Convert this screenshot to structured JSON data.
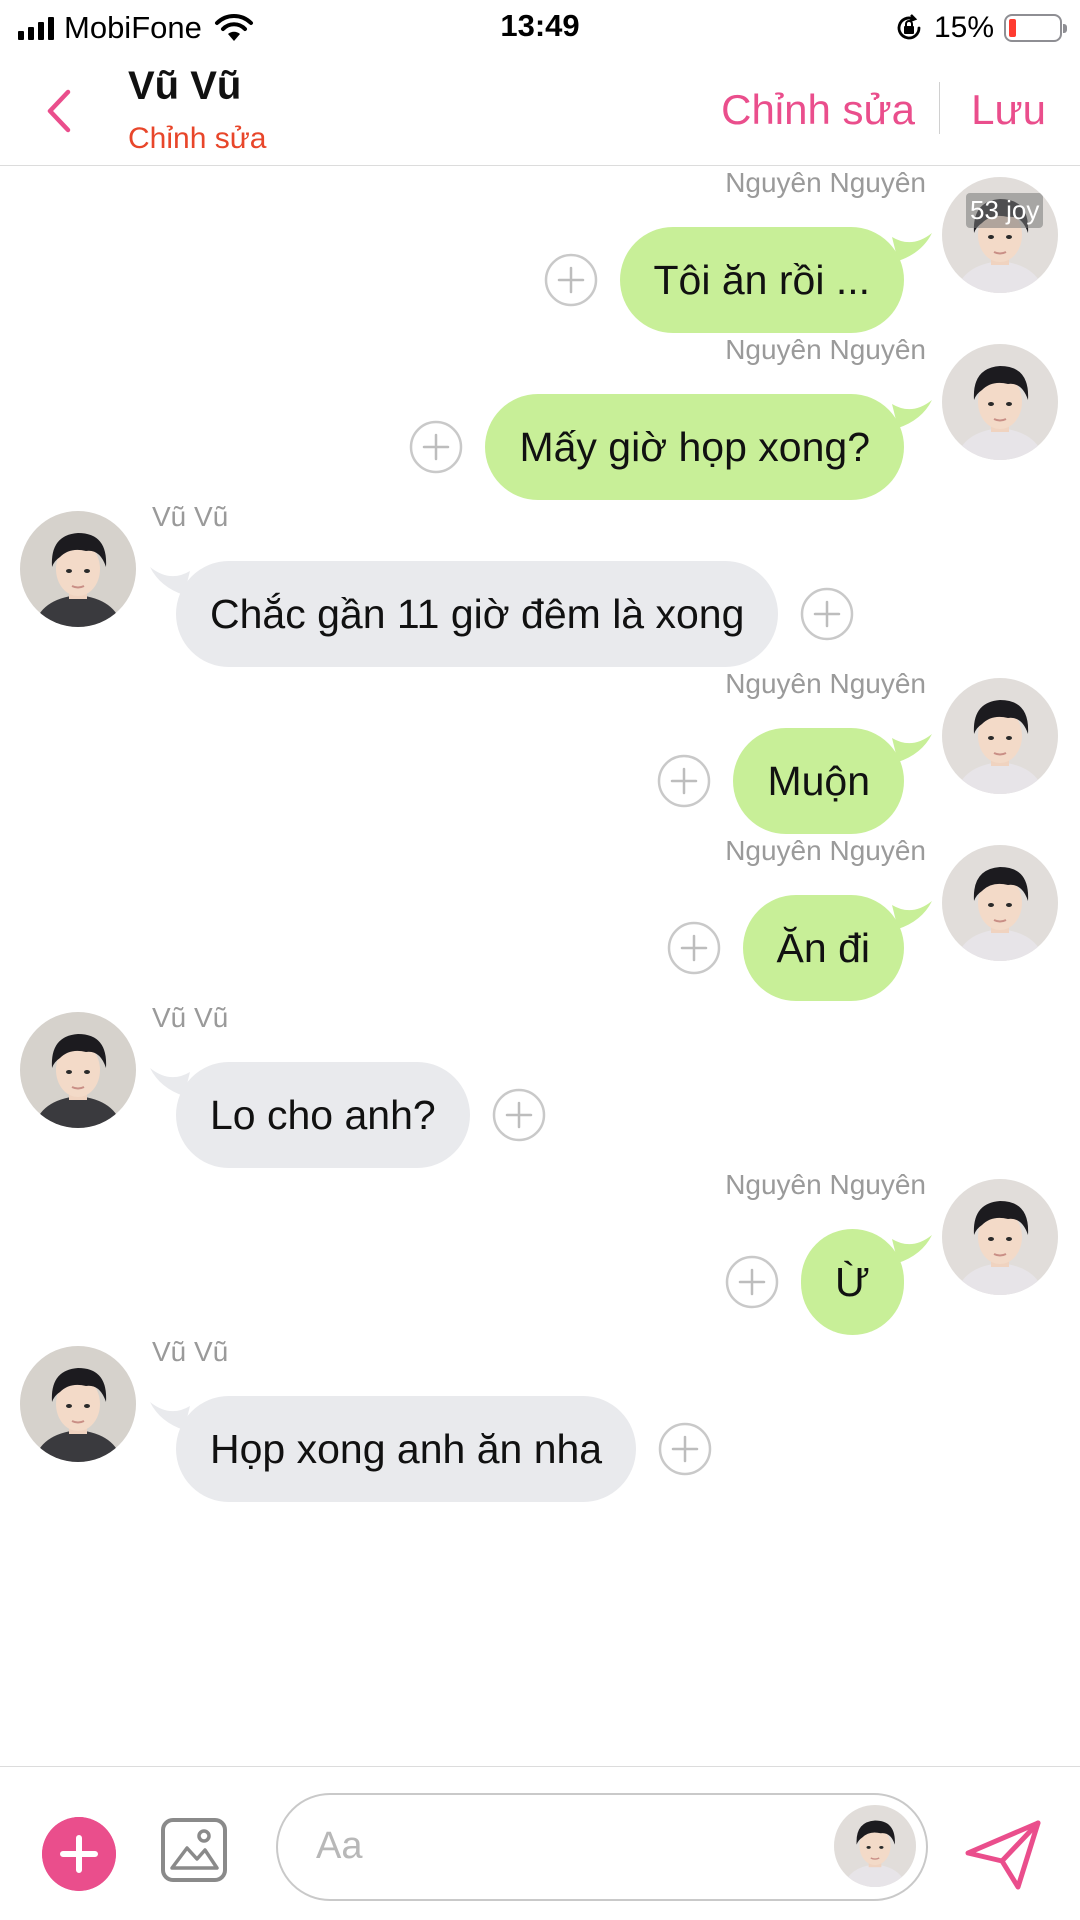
{
  "status_bar": {
    "carrier": "MobiFone",
    "time": "13:49",
    "battery_percent": "15%",
    "battery_level": 0.15,
    "icons": [
      "signal-icon",
      "wifi-icon",
      "orientation-lock-icon",
      "battery-icon"
    ]
  },
  "header": {
    "title": "Vũ Vũ",
    "subtitle": "Chỉnh sửa",
    "edit_label": "Chỉnh sửa",
    "save_label": "Lưu",
    "back_icon": "chevron-left-icon",
    "accent_color": "#ea4e8c",
    "subtitle_color": "#e8462a"
  },
  "chat": {
    "watermark": "53 joy",
    "outgoing_bubble_color": "#c8ef98",
    "incoming_bubble_color": "#e9eaed",
    "messages": [
      {
        "direction": "out",
        "sender": "Nguyên Nguyên",
        "text": "Tôi ăn rồi ..."
      },
      {
        "direction": "out",
        "sender": "Nguyên Nguyên",
        "text": "Mấy giờ họp xong?"
      },
      {
        "direction": "in",
        "sender": "Vũ Vũ",
        "text": "Chắc gần 11 giờ đêm là xong"
      },
      {
        "direction": "out",
        "sender": "Nguyên Nguyên",
        "text": "Muộn"
      },
      {
        "direction": "out",
        "sender": "Nguyên Nguyên",
        "text": "Ăn đi"
      },
      {
        "direction": "in",
        "sender": "Vũ Vũ",
        "text": "Lo cho anh?"
      },
      {
        "direction": "out",
        "sender": "Nguyên Nguyên",
        "text": "Ừ"
      },
      {
        "direction": "in",
        "sender": "Vũ Vũ",
        "text": "Họp xong anh ăn nha"
      }
    ]
  },
  "composer": {
    "placeholder": "Aa",
    "icons": [
      "add-icon",
      "image-icon",
      "send-icon"
    ]
  }
}
